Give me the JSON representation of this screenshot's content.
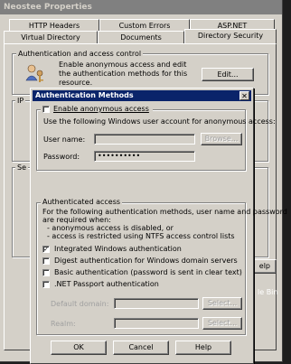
{
  "properties": {
    "title": "Neostee Properties",
    "tabs_row1": [
      "HTTP Headers",
      "Custom Errors",
      "ASP.NET"
    ],
    "tabs_row2": [
      "Virtual Directory",
      "Documents",
      "Directory Security"
    ],
    "auth_group_label": "Authentication and access control",
    "auth_desc": "Enable anonymous access and edit the authentication methods for this resource.",
    "edit_button": "Edit...",
    "ip_group_label_fragment": "IP",
    "secure_group_label_fragment": "Se",
    "help_button_fragment": "elp",
    "bg_text_fragment": "le Bin"
  },
  "dialog": {
    "title": "Authentication Methods",
    "close_glyph": "✕",
    "enable_anonymous": {
      "label": "Enable anonymous access",
      "checked": false
    },
    "anonymous_desc": "Use the following Windows user account for anonymous access:",
    "username_label": "User name:",
    "username_value": "",
    "browse_button": "Browse...",
    "password_label": "Password:",
    "password_value": "••••••••••",
    "authenticated_group_label": "Authenticated access",
    "auth_desc_lines": [
      "For the following authentication methods, user name and password",
      "are required when:",
      "- anonymous access is disabled, or",
      "- access is restricted using NTFS access control lists"
    ],
    "methods": [
      {
        "label": "Integrated Windows authentication",
        "checked": true
      },
      {
        "label": "Digest authentication for Windows domain servers",
        "checked": false
      },
      {
        "label": "Basic authentication (password is sent in clear text)",
        "checked": false
      },
      {
        "label": ".NET Passport authentication",
        "checked": false
      }
    ],
    "default_domain_label": "Default domain:",
    "realm_label": "Realm:",
    "select_button": "Select...",
    "ok_button": "OK",
    "cancel_button": "Cancel",
    "help_button": "Help",
    "check_glyph": "✓"
  }
}
